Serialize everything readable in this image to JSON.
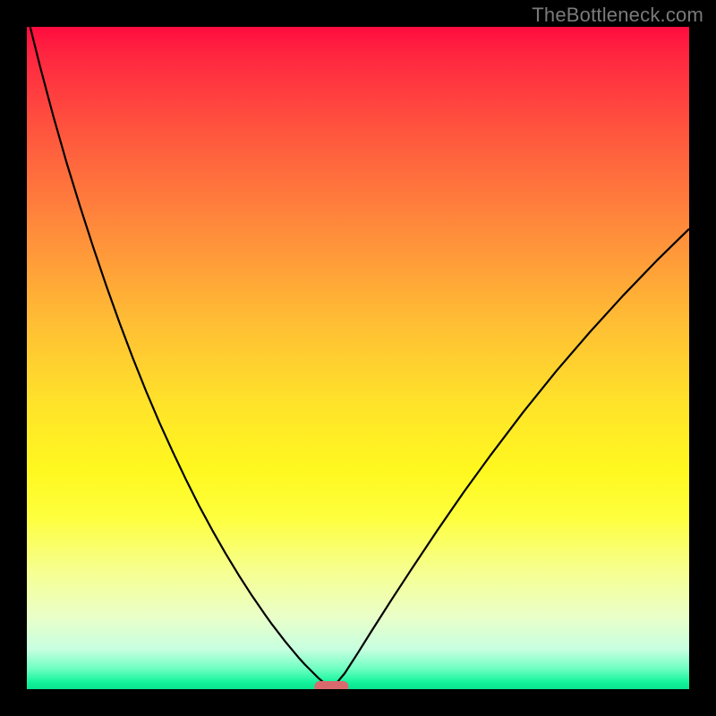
{
  "watermark": "TheBottleneck.com",
  "marker": {
    "color": "#d86a6e"
  },
  "chart_data": {
    "type": "line",
    "title": "",
    "xlabel": "",
    "ylabel": "",
    "xlim": [
      0,
      100
    ],
    "ylim": [
      0,
      100
    ],
    "grid": false,
    "legend": false,
    "x": [
      0,
      2,
      4,
      6,
      8,
      10,
      12,
      14,
      16,
      18,
      20,
      22,
      24,
      26,
      28,
      30,
      32,
      34,
      36,
      37,
      38,
      39,
      40,
      41,
      42,
      43,
      44,
      46,
      48,
      50,
      52,
      55,
      58,
      62,
      66,
      70,
      75,
      80,
      85,
      90,
      95,
      100
    ],
    "values": [
      102,
      94,
      86.5,
      79.5,
      73,
      66.8,
      60.9,
      55.3,
      50,
      45,
      40.3,
      35.9,
      31.7,
      27.7,
      24,
      20.5,
      17.2,
      14.1,
      11.2,
      9.8,
      8.5,
      7.2,
      6,
      4.8,
      3.7,
      2.7,
      1.7,
      0,
      2.4,
      5.5,
      8.7,
      13.4,
      18,
      24,
      29.8,
      35.3,
      41.9,
      48.1,
      53.9,
      59.4,
      64.6,
      69.5
    ],
    "annotations": []
  }
}
